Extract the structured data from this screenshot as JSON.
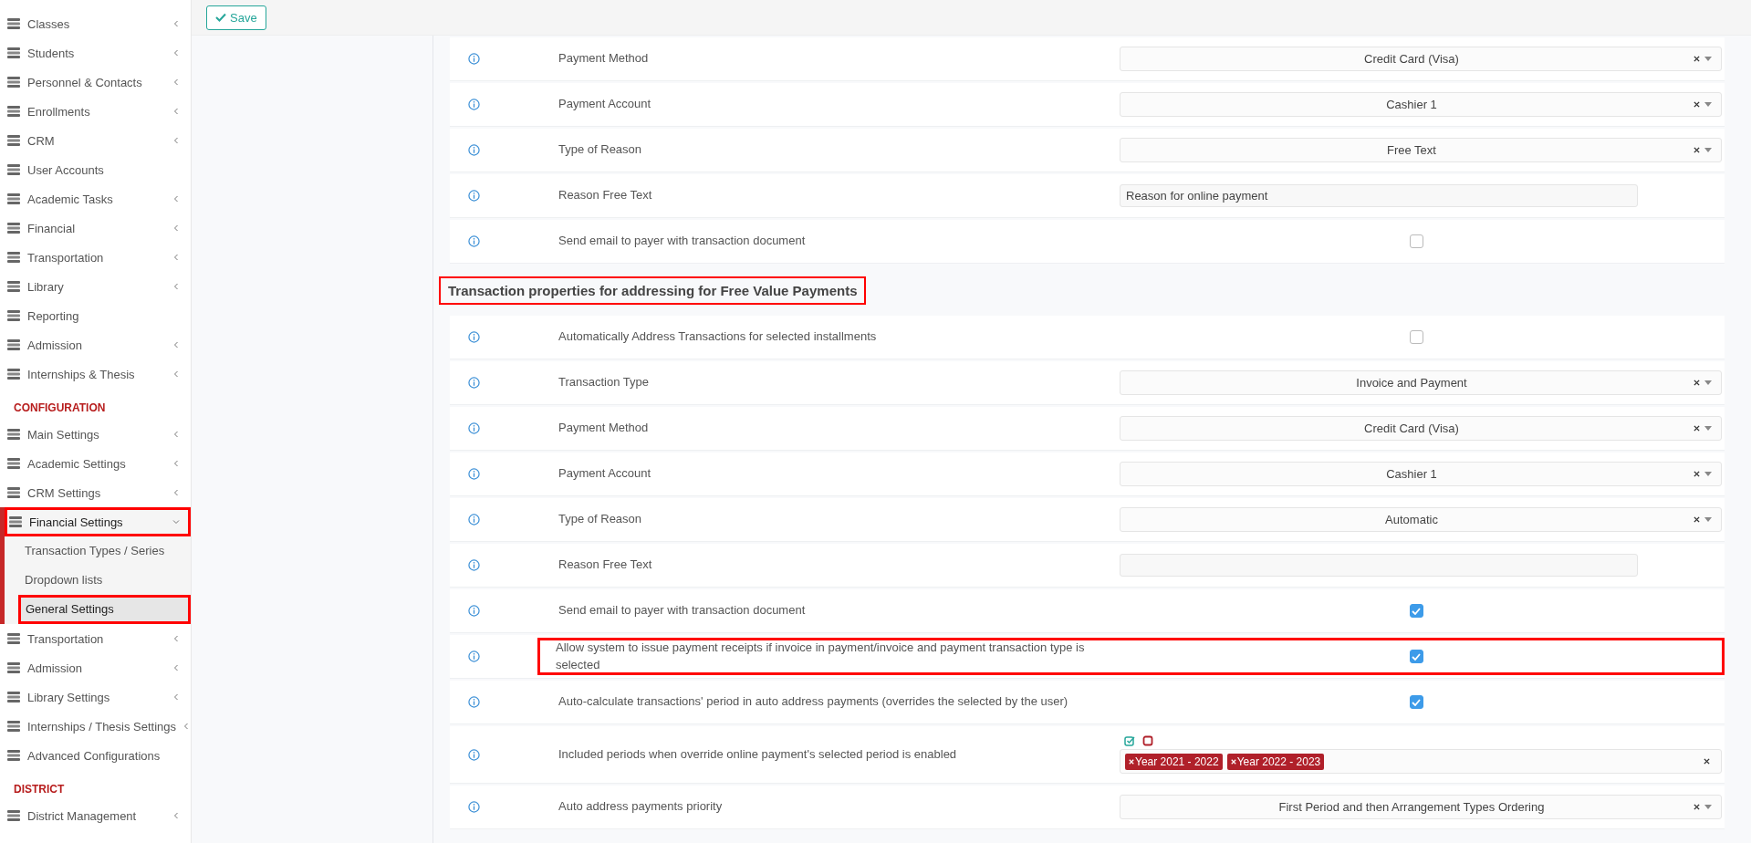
{
  "sidebar": {
    "sections": [
      {
        "items": [
          {
            "label": "Classes",
            "expandable": true,
            "expanded": false,
            "highlighted": false
          },
          {
            "label": "Students",
            "expandable": true,
            "expanded": false,
            "highlighted": false
          },
          {
            "label": "Personnel & Contacts",
            "expandable": true,
            "expanded": false,
            "highlighted": false
          },
          {
            "label": "Enrollments",
            "expandable": true,
            "expanded": false,
            "highlighted": false
          },
          {
            "label": "CRM",
            "expandable": true,
            "expanded": false,
            "highlighted": false
          },
          {
            "label": "User Accounts",
            "expandable": false,
            "expanded": false,
            "highlighted": false
          },
          {
            "label": "Academic Tasks",
            "expandable": true,
            "expanded": false,
            "highlighted": false
          },
          {
            "label": "Financial",
            "expandable": true,
            "expanded": false,
            "highlighted": false
          },
          {
            "label": "Transportation",
            "expandable": true,
            "expanded": false,
            "highlighted": false
          },
          {
            "label": "Library",
            "expandable": true,
            "expanded": false,
            "highlighted": false
          },
          {
            "label": "Reporting",
            "expandable": false,
            "expanded": false,
            "highlighted": false
          },
          {
            "label": "Admission",
            "expandable": true,
            "expanded": false,
            "highlighted": false
          },
          {
            "label": "Internships & Thesis",
            "expandable": true,
            "expanded": false,
            "highlighted": false
          }
        ]
      },
      {
        "title": "CONFIGURATION",
        "items": [
          {
            "label": "Main Settings",
            "expandable": true,
            "expanded": false,
            "highlighted": false
          },
          {
            "label": "Academic Settings",
            "expandable": true,
            "expanded": false,
            "highlighted": false
          },
          {
            "label": "CRM Settings",
            "expandable": true,
            "expanded": false,
            "highlighted": false
          },
          {
            "label": "Financial Settings",
            "expandable": true,
            "expanded": true,
            "highlighted": true,
            "children": [
              {
                "label": "Transaction Types / Series",
                "highlighted": false,
                "selected": false
              },
              {
                "label": "Dropdown lists",
                "highlighted": false,
                "selected": false
              },
              {
                "label": "General Settings",
                "highlighted": true,
                "selected": true
              }
            ]
          },
          {
            "label": "Transportation",
            "expandable": true,
            "expanded": false,
            "highlighted": false
          },
          {
            "label": "Admission",
            "expandable": true,
            "expanded": false,
            "highlighted": false
          },
          {
            "label": "Library Settings",
            "expandable": true,
            "expanded": false,
            "highlighted": false
          },
          {
            "label": "Internships / Thesis Settings",
            "expandable": true,
            "expanded": false,
            "highlighted": false
          },
          {
            "label": "Advanced Configurations",
            "expandable": false,
            "expanded": false,
            "highlighted": false
          }
        ]
      },
      {
        "title": "DISTRICT",
        "items": [
          {
            "label": "District Management",
            "expandable": true,
            "expanded": false,
            "highlighted": false
          }
        ]
      }
    ]
  },
  "toolbar": {
    "save_button": "Save"
  },
  "groups": [
    {
      "rows": [
        {
          "label": "Payment Method",
          "kind": "select",
          "value": "Credit Card (Visa)",
          "highlighted": false
        },
        {
          "label": "Payment Account",
          "kind": "select",
          "value": "Cashier 1",
          "highlighted": false
        },
        {
          "label": "Type of Reason",
          "kind": "select",
          "value": "Free Text",
          "highlighted": false
        },
        {
          "label": "Reason Free Text",
          "kind": "text",
          "value": "Reason for online payment",
          "highlighted": false
        },
        {
          "label": "Send email to payer with transaction document",
          "kind": "checkbox",
          "checked": false,
          "highlighted": false
        }
      ]
    },
    {
      "heading": "Transaction properties for addressing for Free Value Payments",
      "highlighted": true,
      "rows": [
        {
          "label": "Automatically Address Transactions for selected installments",
          "kind": "checkbox",
          "checked": false,
          "highlighted": false
        },
        {
          "label": "Transaction Type",
          "kind": "select",
          "value": "Invoice and Payment",
          "highlighted": false
        },
        {
          "label": "Payment Method",
          "kind": "select",
          "value": "Credit Card (Visa)",
          "highlighted": false
        },
        {
          "label": "Payment Account",
          "kind": "select",
          "value": "Cashier 1",
          "highlighted": false
        },
        {
          "label": "Type of Reason",
          "kind": "select",
          "value": "Automatic",
          "highlighted": false
        },
        {
          "label": "Reason Free Text",
          "kind": "text",
          "value": "",
          "highlighted": false
        },
        {
          "label": "Send email to payer with transaction document",
          "kind": "checkbox",
          "checked": true,
          "highlighted": false
        },
        {
          "label": "Allow system to issue payment receipts if invoice in payment/invoice and payment transaction type is selected",
          "kind": "checkbox",
          "checked": true,
          "highlighted": true
        },
        {
          "label": "Auto-calculate transactions' period in auto address payments (overrides the selected by the user)",
          "kind": "checkbox",
          "checked": true,
          "highlighted": false
        },
        {
          "label": "Included periods when override online payment's selected period is enabled",
          "kind": "tags",
          "tags": [
            "Year 2021 - 2022",
            "Year 2022 - 2023"
          ],
          "highlighted": false
        },
        {
          "label": "Auto address payments priority",
          "kind": "select",
          "value": "First Period and then Arrangement Types Ordering",
          "highlighted": false
        }
      ]
    }
  ]
}
